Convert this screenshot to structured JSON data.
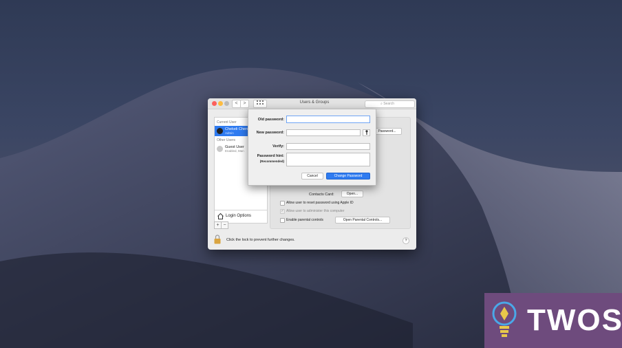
{
  "window": {
    "title": "Users & Groups",
    "search_placeholder": "Search",
    "nav_back": "<",
    "nav_forward": ">",
    "grid_icon": "grid-icon"
  },
  "sidebar": {
    "current_user_label": "Current User",
    "current_user_name": "Chekeli Chen",
    "current_user_role": "Admin",
    "other_users_label": "Other Users",
    "guest_user_name": "Guest User",
    "guest_user_sub": "Enabled, Man",
    "login_options": "Login Options",
    "add_label": "+",
    "remove_label": "−"
  },
  "panel": {
    "change_password_button": "Password...",
    "contacts_card_label": "Contacts Card:",
    "open_button": "Open...",
    "allow_reset": "Allow user to reset password using Apple ID",
    "allow_admin": "Allow user to administer this computer",
    "enable_parental": "Enable parental controls",
    "open_parental_button": "Open Parental Controls..."
  },
  "lockbar": {
    "text": "Click the lock to prevent further changes.",
    "help": "?"
  },
  "dialog": {
    "old_password_label": "Old password:",
    "new_password_label": "New password:",
    "verify_label": "Verify:",
    "hint_label": "Password hint:",
    "hint_sub": "(Recommended)",
    "cancel": "Cancel",
    "change_password": "Change Password"
  },
  "logo": {
    "text": "TWOS"
  },
  "colors": {
    "accent": "#2f7bf0",
    "close": "#fc605c",
    "minimize": "#fdbc40",
    "logo_bg": "#6e4b7d"
  }
}
